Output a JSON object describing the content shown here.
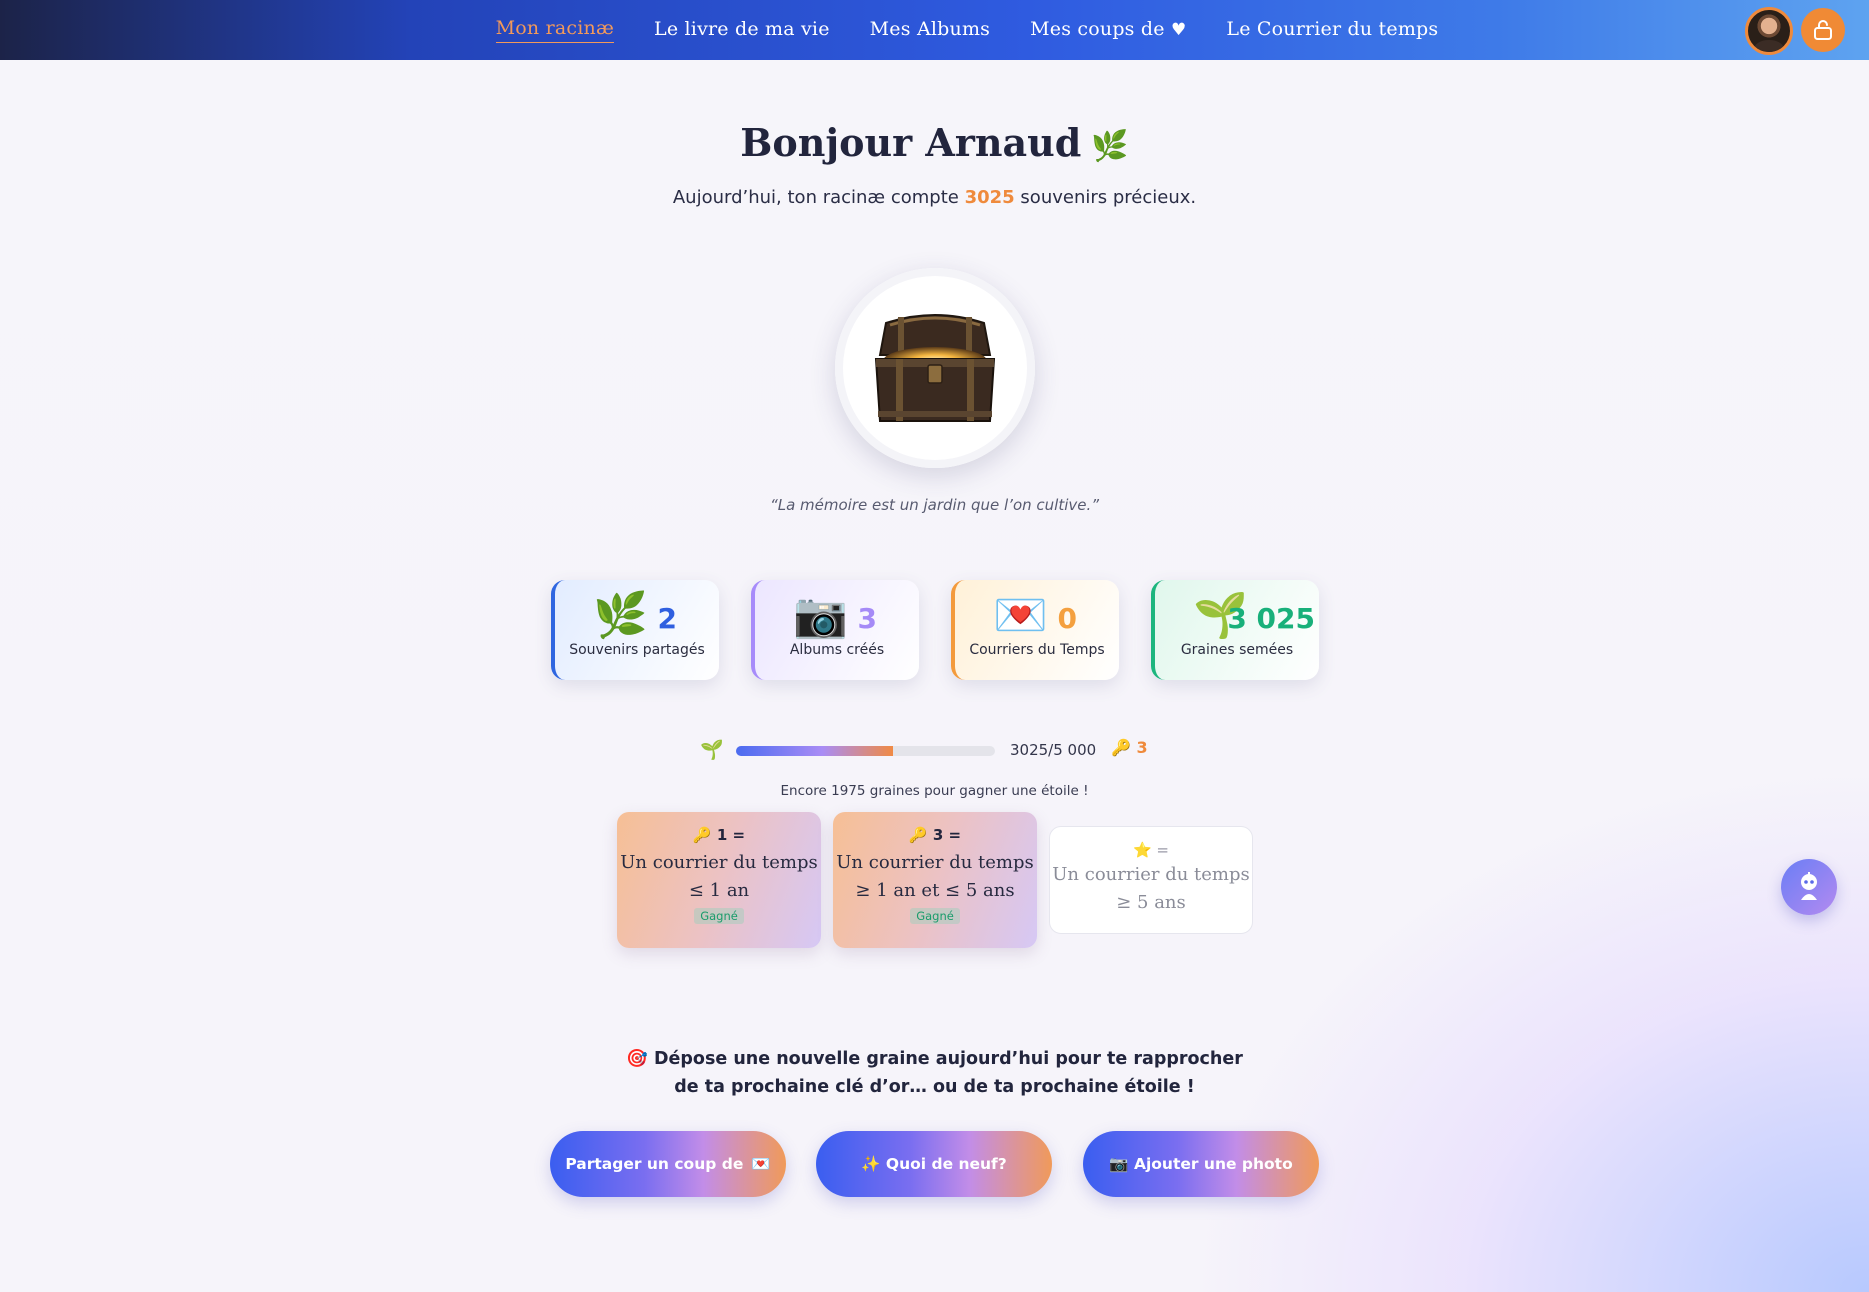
{
  "nav": {
    "links": [
      {
        "label": "Mon racinæ",
        "active": true
      },
      {
        "label": "Le livre de ma vie"
      },
      {
        "label": "Mes Albums"
      },
      {
        "label": "Mes coups de",
        "suffix": "♥"
      },
      {
        "label": "Le Courrier du temps"
      }
    ],
    "avatar_icon": "user-avatar",
    "lock_icon": "lock-icon"
  },
  "hero": {
    "greeting": "Bonjour Arnaud",
    "greeting_emoji": "🌿",
    "subtitle_prefix": "Aujourd’hui, ton racinæ compte",
    "subtitle_count": "3025",
    "subtitle_suffix": "souvenirs précieux.",
    "quote": "“La mémoire est un jardin que l’on cultive.”"
  },
  "stats": [
    {
      "icon": "🌿",
      "value": "2",
      "label": "Souvenirs partagés",
      "accent": "#2f5fe0"
    },
    {
      "icon": "📷",
      "value": "3",
      "label": "Albums créés",
      "accent": "#a58af7"
    },
    {
      "icon": "💌",
      "value": "0",
      "label": "Courriers du Temps",
      "accent": "#f4a03f"
    },
    {
      "icon": "🌱",
      "value": "3 025",
      "label": "Graines semées",
      "accent": "#18b07a"
    }
  ],
  "progress": {
    "icon": "🌱",
    "current": 3025,
    "goal": 5000,
    "text": "3025/5 000",
    "key_icon": "🔑",
    "keys": "3",
    "remaining_text": "Encore 1975 graines pour gagner une étoile !"
  },
  "rewards": [
    {
      "head": "🔑 1 =",
      "line1": "Un courrier du temps",
      "line2": "≤ 1 an",
      "badge": "Gagné"
    },
    {
      "head": "🔑 3 =",
      "line1": "Un courrier du temps",
      "line2": "≥ 1 an et ≤ 5 ans",
      "badge": "Gagné"
    },
    {
      "head": "⭐ =",
      "line1": "Un courrier du temps",
      "line2": "≥ 5 ans"
    }
  ],
  "cta": {
    "line1": "🎯 Dépose une nouvelle graine aujourd’hui pour te rapprocher",
    "line2": "de ta prochaine clé d’or… ou de ta prochaine étoile !",
    "buttons": [
      {
        "label": "Partager un coup de",
        "emoji": "💌"
      },
      {
        "label": "✨ Quoi de neuf?"
      },
      {
        "label": "📷 Ajouter une photo"
      }
    ]
  },
  "chatbot_icon": "robot-icon",
  "colors": {
    "accent_orange": "#ef8a3c",
    "nav_start": "#1c2348",
    "nav_end": "#5ea3f0"
  }
}
